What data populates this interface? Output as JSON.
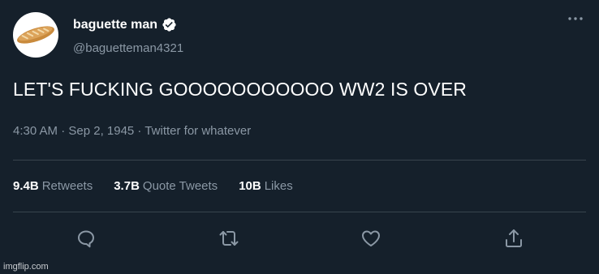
{
  "tweet": {
    "display_name": "baguette man",
    "handle": "@baguetteman4321",
    "text": "LET'S FUCKING GOOOOOOOOOOO WW2 IS OVER",
    "meta": "4:30 AM · Sep 2, 1945 · Twitter for whatever"
  },
  "stats": {
    "retweets": {
      "value": "9.4B",
      "label": "Retweets"
    },
    "quote_tweets": {
      "value": "3.7B",
      "label": "Quote Tweets"
    },
    "likes": {
      "value": "10B",
      "label": "Likes"
    }
  },
  "icons": {
    "avatar": "baguette-image",
    "verified": "verified-badge-icon",
    "more": "more-options-icon",
    "reply": "reply-icon",
    "retweet": "retweet-icon",
    "like": "heart-icon",
    "share": "share-icon"
  },
  "colors": {
    "background": "#15202b",
    "secondary_text": "#8b98a5",
    "divider": "#38444d",
    "verified": "#1d9bf0"
  },
  "watermark": "imgflip.com"
}
